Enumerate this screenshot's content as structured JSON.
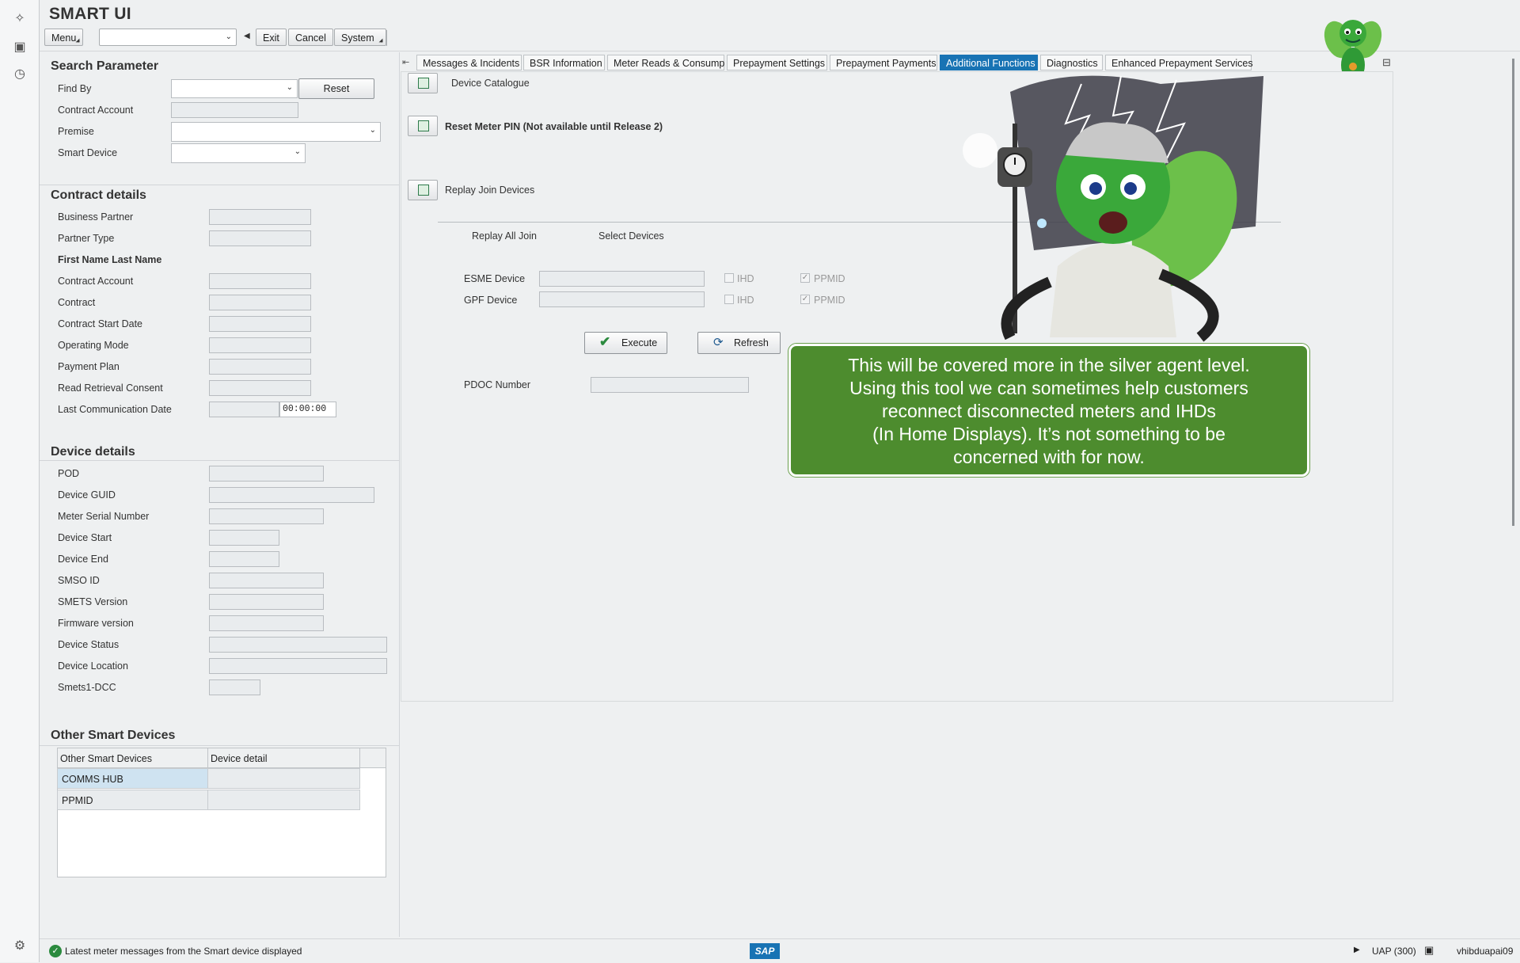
{
  "app": {
    "title": "SMART UI"
  },
  "toolbar": {
    "menu": "Menu",
    "exit": "Exit",
    "cancel": "Cancel",
    "system": "System"
  },
  "search": {
    "title": "Search Parameter",
    "find_by": "Find By",
    "reset": "Reset",
    "contract_account": "Contract Account",
    "premise": "Premise",
    "smart_device": "Smart Device"
  },
  "contract": {
    "title": "Contract details",
    "labels": [
      "Business Partner",
      "Partner Type",
      "First Name Last Name",
      "Contract Account",
      "Contract",
      "Contract Start Date",
      "Operating Mode",
      "Payment Plan",
      "Read Retrieval Consent",
      "Last Communication Date"
    ],
    "last_comm_time": "00:00:00"
  },
  "device": {
    "title": "Device details",
    "labels": [
      "POD",
      "Device GUID",
      "Meter Serial Number",
      "Device Start",
      "Device End",
      "SMSO ID",
      "SMETS Version",
      "Firmware version",
      "Device Status",
      "Device Location",
      "Smets1-DCC"
    ]
  },
  "other": {
    "title": "Other Smart Devices",
    "columns": [
      "Other Smart Devices",
      "Device detail"
    ],
    "rows": [
      "COMMS HUB",
      "PPMID"
    ]
  },
  "tabs": [
    "Messages & Incidents",
    "BSR Information",
    "Meter Reads & Consump",
    "Prepayment Settings",
    "Prepayment Payments",
    "Additional Functions",
    "Diagnostics",
    "Enhanced Prepayment Services"
  ],
  "functions": {
    "device_catalogue": "Device Catalogue",
    "reset_pin": "Reset Meter PIN (Not available until Release 2)",
    "replay_join": "Replay Join Devices",
    "replay_all": "Replay All Join",
    "select_devices": "Select Devices",
    "esme": "ESME Device",
    "gpf": "GPF Device",
    "ihd": "IHD",
    "ppmid": "PPMID",
    "execute": "Execute",
    "refresh": "Refresh",
    "pdoc": "PDOC Number"
  },
  "callout": {
    "lines": [
      "This will be covered more in the silver agent level.",
      "Using this tool we can sometimes help customers",
      "reconnect disconnected meters and IHDs",
      "(In Home Displays). It’s not something to be",
      "concerned with for now."
    ]
  },
  "status": {
    "message": "Latest meter messages from the Smart device displayed",
    "system": "UAP (300)",
    "user": "vhibduapai09",
    "sap": "SAP"
  },
  "colors": {
    "active_tab": "#1873b4",
    "callout": "#4d8c2e",
    "mascot": "#3ba33b"
  }
}
